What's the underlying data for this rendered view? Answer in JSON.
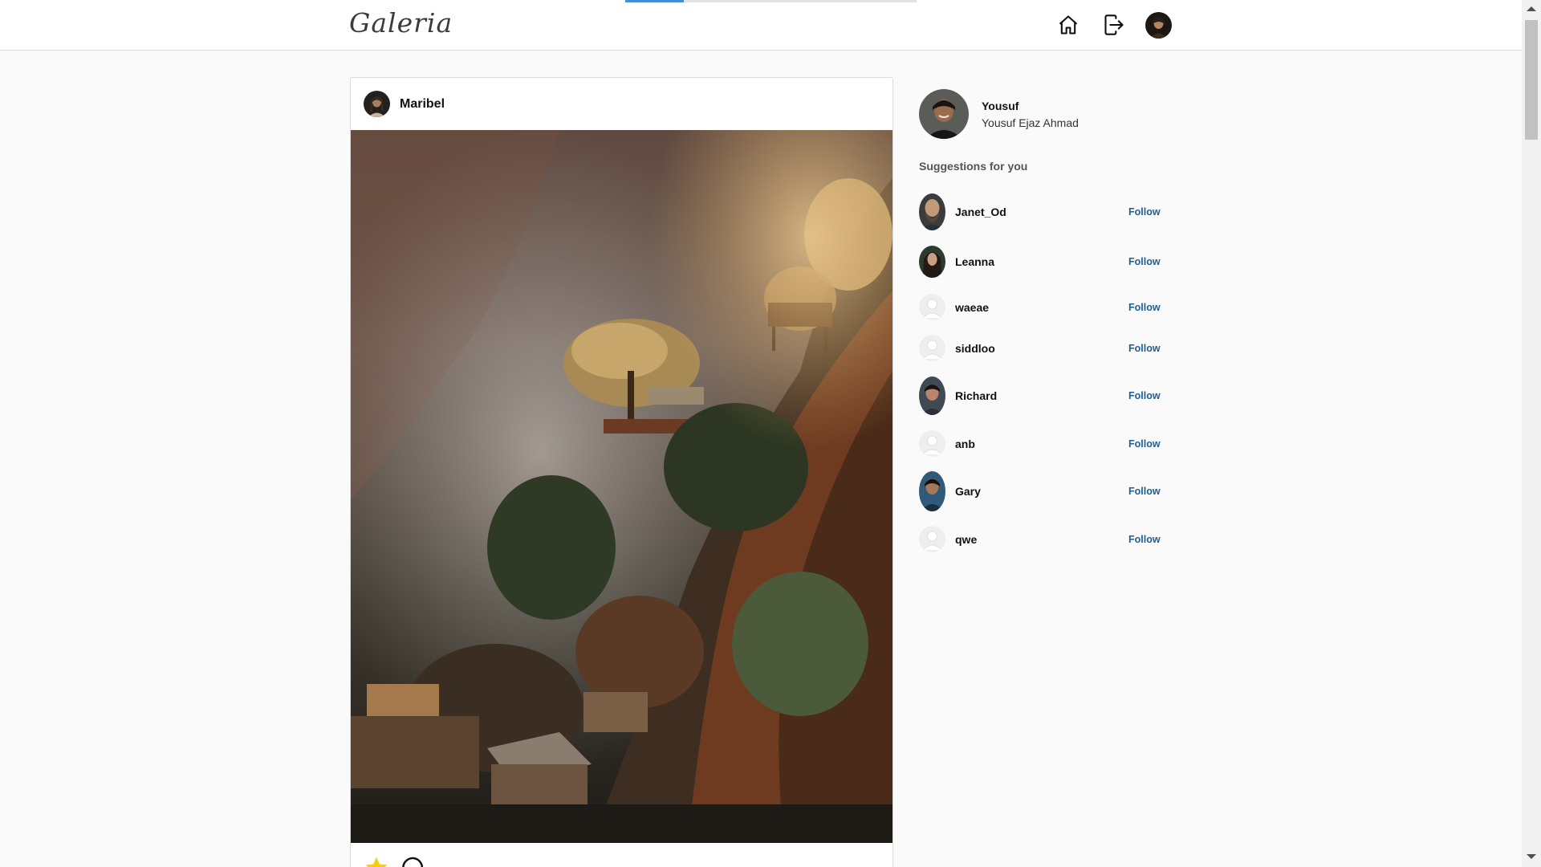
{
  "app": {
    "logo": "Galeria"
  },
  "header": {
    "loading_progress": 0.2,
    "icons": [
      "home-icon",
      "logout-icon",
      "user-avatar"
    ]
  },
  "post": {
    "username": "Maribel",
    "image": "Misty cliffside with trees and small houses, warm sunlight",
    "actions": [
      "star-icon",
      "comment-icon"
    ],
    "colors": {
      "star": "#f7d000"
    }
  },
  "sidebar": {
    "me": {
      "username": "Yousuf",
      "full_name": "Yousuf Ejaz Ahmad"
    },
    "suggestions_title": "Suggestions for you",
    "suggestions": [
      {
        "username": "Janet_Od",
        "follow_label": "Follow",
        "avatar": "photo"
      },
      {
        "username": "Leanna",
        "follow_label": "Follow",
        "avatar": "photo"
      },
      {
        "username": "waeae",
        "follow_label": "Follow",
        "avatar": "default"
      },
      {
        "username": "siddloo",
        "follow_label": "Follow",
        "avatar": "default"
      },
      {
        "username": "Richard",
        "follow_label": "Follow",
        "avatar": "photo"
      },
      {
        "username": "anb",
        "follow_label": "Follow",
        "avatar": "default"
      },
      {
        "username": "Gary",
        "follow_label": "Follow",
        "avatar": "photo"
      },
      {
        "username": "qwe",
        "follow_label": "Follow",
        "avatar": "default"
      }
    ]
  },
  "colors": {
    "accent": "#1d5f97",
    "progress": "#3f8fd6",
    "background": "#fafafa"
  }
}
